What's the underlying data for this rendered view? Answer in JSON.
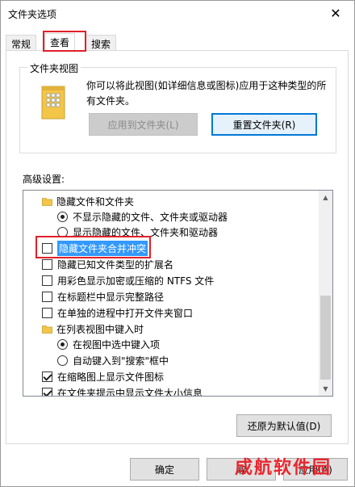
{
  "window": {
    "title": "文件夹选项"
  },
  "tabs": [
    {
      "label": "常规"
    },
    {
      "label": "查看"
    },
    {
      "label": "搜索"
    }
  ],
  "folder_views": {
    "label": "文件夹视图",
    "description": "你可以将此视图(如详细信息或图标)应用于这种类型的所有文件夹。",
    "apply_button": "应用到文件夹(L)",
    "reset_button": "重置文件夹(R)"
  },
  "advanced": {
    "label": "高级设置:",
    "items": [
      {
        "type": "folder",
        "label": "隐藏文件和文件夹"
      },
      {
        "type": "radio",
        "label": "不显示隐藏的文件、文件夹或驱动器",
        "selected": true
      },
      {
        "type": "radio",
        "label": "显示隐藏的文件、文件夹和驱动器",
        "selected": false
      },
      {
        "type": "checkbox",
        "label": "隐藏文件夹合并冲突",
        "checked": false
      },
      {
        "type": "checkbox",
        "label": "隐藏已知文件类型的扩展名",
        "checked": false
      },
      {
        "type": "checkbox",
        "label": "用彩色显示加密或压缩的 NTFS 文件",
        "checked": false
      },
      {
        "type": "checkbox",
        "label": "在标题栏中显示完整路径",
        "checked": false
      },
      {
        "type": "checkbox",
        "label": "在单独的进程中打开文件夹窗口",
        "checked": false
      },
      {
        "type": "folder",
        "label": "在列表视图中键入时"
      },
      {
        "type": "radio",
        "label": "在视图中选中键入项",
        "selected": true
      },
      {
        "type": "radio",
        "label": "自动键入到\"搜索\"框中",
        "selected": false
      },
      {
        "type": "checkbox",
        "label": "在缩略图上显示文件图标",
        "checked": true
      },
      {
        "type": "checkbox",
        "label": "在文件夹提示中显示文件大小信息",
        "checked": true
      }
    ],
    "restore_button": "还原为默认值(D)"
  },
  "footer": {
    "ok_button": "确定",
    "cancel_button": "取",
    "apply_button": "应用(A)"
  },
  "watermark": "成航软件园",
  "colors": {
    "accent": "#0078d7",
    "selection": "#3399ff",
    "highlight_box": "#e0202a",
    "folder": "#f3c548"
  }
}
